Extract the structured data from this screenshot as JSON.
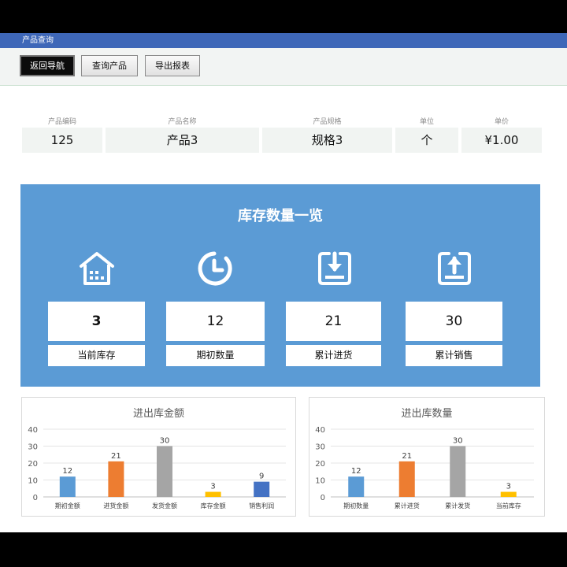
{
  "window": {
    "title": "产品查询"
  },
  "toolbar": {
    "back_label": "返回导航",
    "query_label": "查询产品",
    "export_label": "导出报表"
  },
  "product": {
    "headers": [
      "产品编码",
      "产品名称",
      "产品规格",
      "单位",
      "单价"
    ],
    "values": [
      "125",
      "产品3",
      "规格3",
      "个",
      "¥1.00"
    ]
  },
  "inventory": {
    "title": "库存数量一览",
    "cards": [
      {
        "icon": "warehouse-icon",
        "value": "3",
        "label": "当前库存"
      },
      {
        "icon": "clock-icon",
        "value": "12",
        "label": "期初数量"
      },
      {
        "icon": "download-box-icon",
        "value": "21",
        "label": "累计进货"
      },
      {
        "icon": "upload-box-icon",
        "value": "30",
        "label": "累计销售"
      }
    ]
  },
  "chart_data": [
    {
      "type": "bar",
      "title": "进出库金额",
      "categories": [
        "期初金额",
        "进货金额",
        "发货金额",
        "库存金额",
        "销售利润"
      ],
      "values": [
        12,
        21,
        30,
        3,
        9
      ],
      "colors": [
        "#5b9bd5",
        "#ed7d31",
        "#a5a5a5",
        "#ffc000",
        "#4472c4"
      ],
      "ylim": [
        0,
        40
      ],
      "yticks": [
        0,
        10,
        20,
        30,
        40
      ],
      "grid": true
    },
    {
      "type": "bar",
      "title": "进出库数量",
      "categories": [
        "期初数量",
        "累计进货",
        "累计发货",
        "当前库存"
      ],
      "values": [
        12,
        21,
        30,
        3
      ],
      "colors": [
        "#5b9bd5",
        "#ed7d31",
        "#a5a5a5",
        "#ffc000"
      ],
      "ylim": [
        0,
        40
      ],
      "yticks": [
        0,
        10,
        20,
        30,
        40
      ],
      "grid": true
    }
  ]
}
